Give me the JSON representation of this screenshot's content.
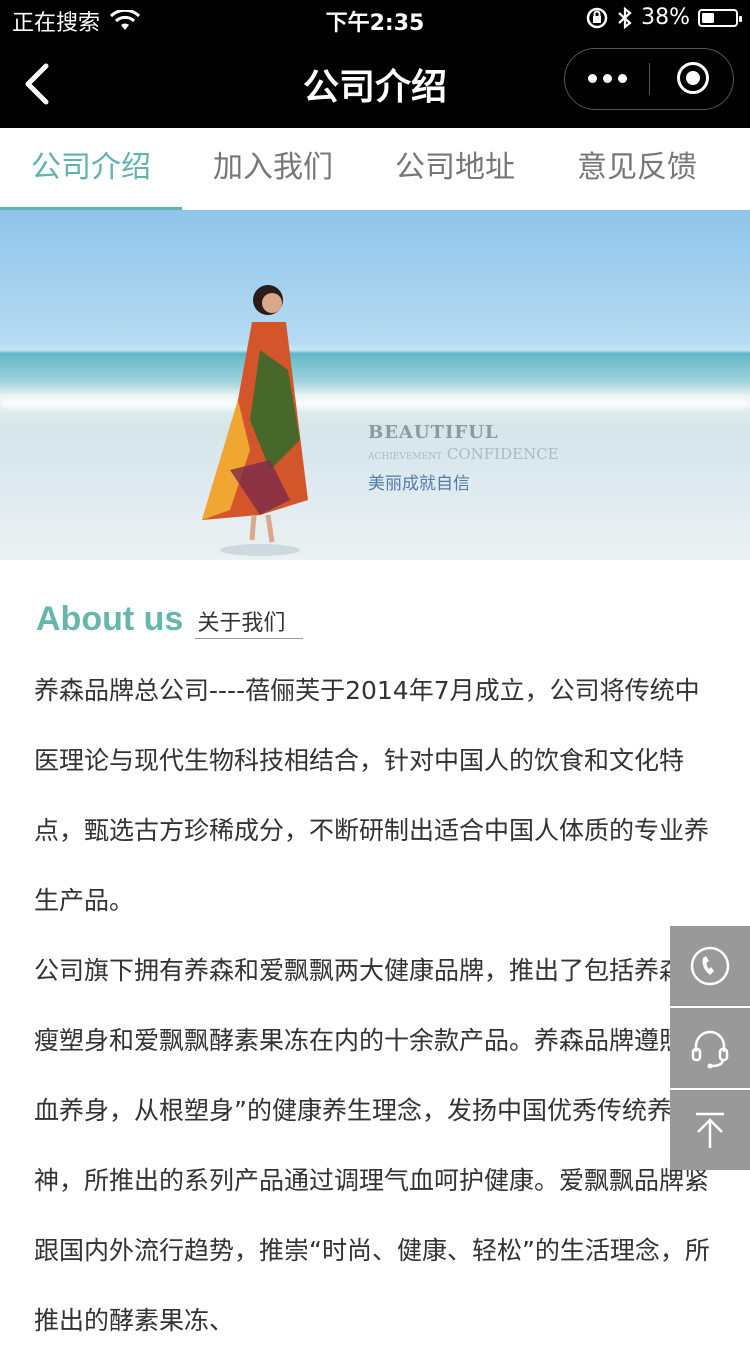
{
  "status_bar": {
    "carrier": "正在搜索",
    "time": "下午2:35",
    "battery_percent": "38%",
    "battery_level": 0.38
  },
  "nav": {
    "title": "公司介绍"
  },
  "tabs": [
    {
      "label": "公司介绍",
      "active": true
    },
    {
      "label": "加入我们",
      "active": false
    },
    {
      "label": "公司地址",
      "active": false
    },
    {
      "label": "意见反馈",
      "active": false
    }
  ],
  "banner": {
    "line1": "BEAUTIFUL",
    "line2_small": "ACHIEVEMENT",
    "line2": "CONFIDENCE",
    "line3": "美丽成就自信"
  },
  "about": {
    "title_en": "About us",
    "title_cn": "关于我们",
    "paragraph1": "养森品牌总公司----蓓俪芙于2014年7月成立，公司将传统中医理论与现代生物科技相结合，针对中国人的饮食和文化特点，甄选古方珍稀成分，不断研制出适合中国人体质的专业养生产品。",
    "paragraph2": "公司旗下拥有养森和爱飘飘两大健康品牌，推出了包括养森瘦瘦塑身和爱飘飘酵素果冻在内的十余款产品。养森品牌遵照“气血养身，从根塑身”的健康养生理念，发扬中国优秀传统养生精神，所推出的系列产品通过调理气血呵护健康。爱飘飘品牌紧跟国内外流行趋势，推崇“时尚、健康、轻松”的生活理念，所推出的酵素果冻、"
  },
  "float_buttons": [
    {
      "icon": "phone-icon"
    },
    {
      "icon": "headset-icon"
    },
    {
      "icon": "arrow-up-icon"
    }
  ]
}
